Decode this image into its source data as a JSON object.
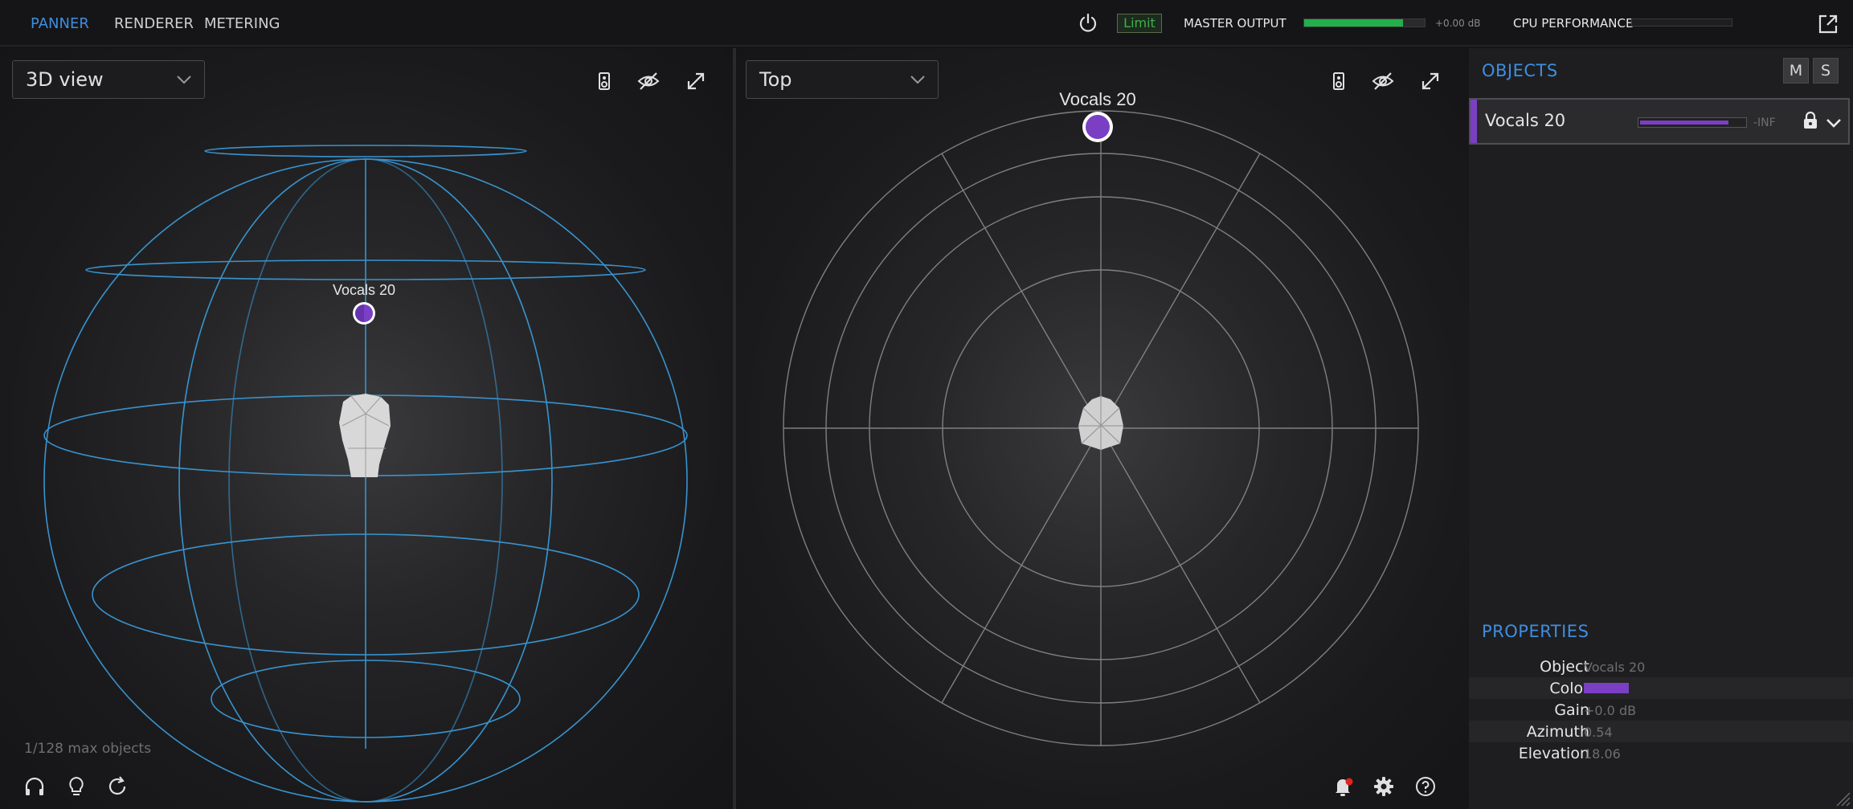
{
  "nav": {
    "tabs": [
      {
        "label": "PANNER",
        "active": true
      },
      {
        "label": "RENDERER",
        "active": false
      },
      {
        "label": "METERING",
        "active": false
      }
    ]
  },
  "topbar": {
    "limit_label": "Limit",
    "master_label": "MASTER OUTPUT",
    "master_level": 0.82,
    "master_db": "+0.00 dB",
    "cpu_label": "CPU PERFORMANCE",
    "cpu_level": 0.0
  },
  "left_view": {
    "dropdown_value": "3D view",
    "object_label": "Vocals 20",
    "object_count": "1/128 max objects"
  },
  "right_view": {
    "dropdown_value": "Top",
    "object_label": "Vocals 20"
  },
  "objects_panel": {
    "title": "OBJECTS",
    "mute_label": "M",
    "solo_label": "S",
    "items": [
      {
        "name": "Vocals 20",
        "level": 0.82,
        "db": "-INF",
        "color": "#7b3fc4"
      }
    ]
  },
  "properties_panel": {
    "title": "PROPERTIES",
    "rows": [
      {
        "key": "Object",
        "value": "Vocals 20"
      },
      {
        "key": "Color",
        "value": "",
        "color": "#7b3fc4"
      },
      {
        "key": "Gain",
        "value": "+0.0 dB"
      },
      {
        "key": "Azimuth",
        "value": "0.54"
      },
      {
        "key": "Elevation",
        "value": "18.06"
      }
    ]
  },
  "colors": {
    "accent": "#3e8ee0",
    "object_purple": "#7b3fc4",
    "meter_green": "#22b04b",
    "sphere_lines": "#3a9ad9"
  },
  "icons": {
    "power": "power-icon",
    "popout": "external-window-icon",
    "speaker": "speaker-icon",
    "visibility": "eye-off-icon",
    "fullscreen": "expand-arrows-icon",
    "headphones": "headphones-icon",
    "lightbulb": "lightbulb-icon",
    "reset": "refresh-icon",
    "notifications": "bell-icon",
    "settings": "gear-icon",
    "help": "help-circle-icon"
  }
}
